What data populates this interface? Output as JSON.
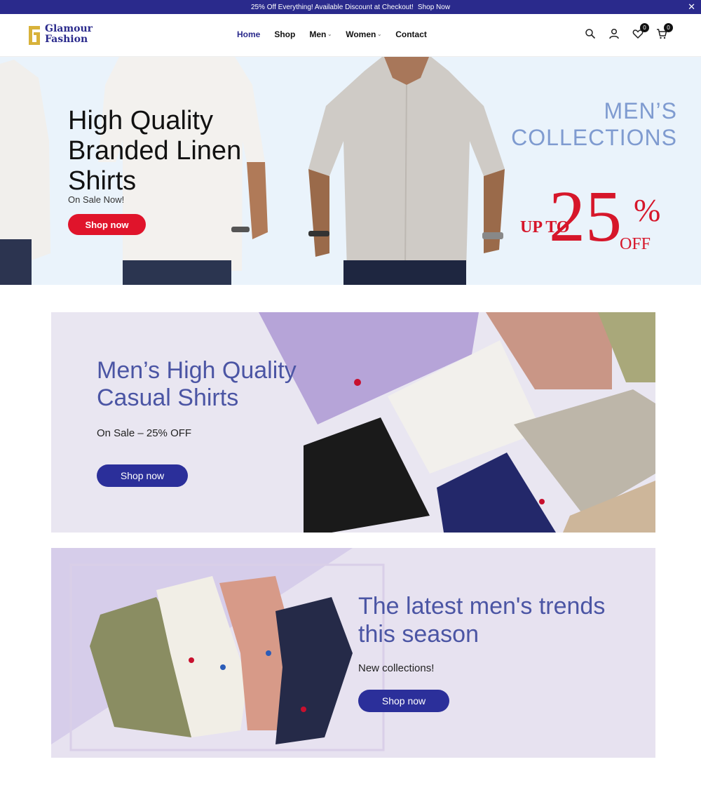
{
  "announcement": {
    "message": "25% Off Everything! Available Discount at Checkout!",
    "link": "Shop Now",
    "close": "✕"
  },
  "brand": {
    "line1": "Glamour",
    "line2": "Fashion",
    "color": "#2a2a8c",
    "logo_color": "#d8b23a"
  },
  "nav": {
    "home": "Home",
    "shop": "Shop",
    "men": "Men",
    "women": "Women",
    "contact": "Contact"
  },
  "header_icons": {
    "search": "search-icon",
    "account": "user-icon",
    "wishlist": "heart-icon",
    "wishlist_count": "0",
    "cart": "cart-icon",
    "cart_count": "0"
  },
  "hero": {
    "title": "High Quality Branded Linen Shirts",
    "subtitle": "On Sale Now!",
    "button": "Shop now",
    "collection_line1": "MEN’S",
    "collection_line2": "COLLECTIONS",
    "upto": "UP TO",
    "discount": "25",
    "percent": "%",
    "off": "OFF",
    "accent": "#d6162a"
  },
  "banner1": {
    "title": "Men’s High Quality Casual Shirts",
    "subtitle": "On Sale – 25% OFF",
    "button": "Shop now"
  },
  "banner2": {
    "title": "The latest men's trends this season",
    "subtitle": "New collections!",
    "button": "Shop now"
  }
}
